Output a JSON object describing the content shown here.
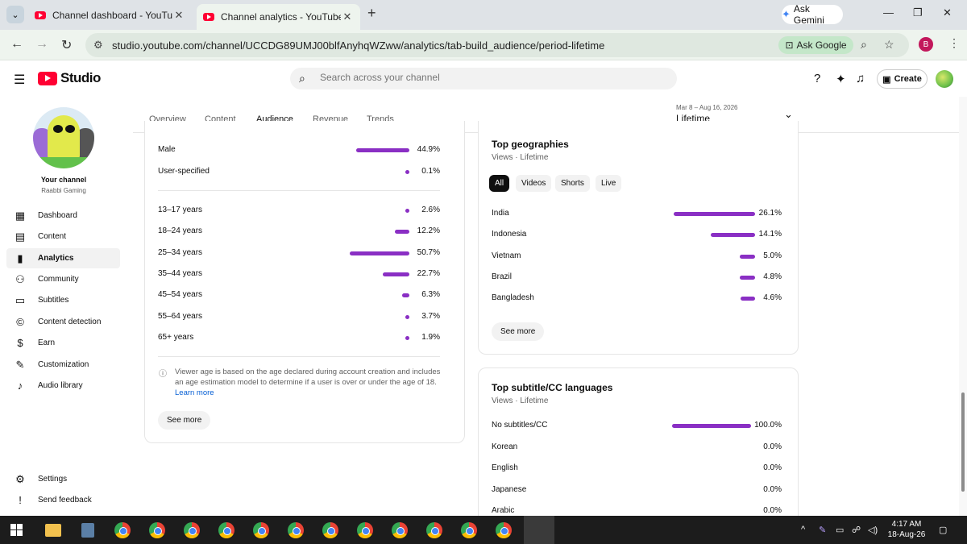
{
  "browser": {
    "tabs": [
      {
        "title": "Channel dashboard - YouTube Studio",
        "active": false
      },
      {
        "title": "Channel analytics - YouTube Studio",
        "active": true
      }
    ],
    "gemini_label": "Ask Gemini",
    "url": "studio.youtube.com/channel/UCCDG89UMJ00blfAnyhqWZww/analytics/tab-build_audience/period-lifetime",
    "ask_google_label": "Ask Google",
    "profile_initial": "B"
  },
  "studio": {
    "logo_text": "Studio",
    "search_placeholder": "Search across your channel",
    "create_label": "Create"
  },
  "sidebar": {
    "channel_label": "Your channel",
    "channel_name": "Raabbi Gaming",
    "items": [
      {
        "label": "Dashboard",
        "icon": "dashboard-icon",
        "active": false
      },
      {
        "label": "Content",
        "icon": "content-icon",
        "active": false
      },
      {
        "label": "Analytics",
        "icon": "analytics-icon",
        "active": true
      },
      {
        "label": "Community",
        "icon": "community-icon",
        "active": false
      },
      {
        "label": "Subtitles",
        "icon": "subtitles-icon",
        "active": false
      },
      {
        "label": "Content detection",
        "icon": "copyright-icon",
        "active": false
      },
      {
        "label": "Earn",
        "icon": "earn-icon",
        "active": false
      },
      {
        "label": "Customization",
        "icon": "customization-icon",
        "active": false
      },
      {
        "label": "Audio library",
        "icon": "audio-library-icon",
        "active": false
      }
    ],
    "bottom_items": [
      {
        "label": "Settings",
        "icon": "gear-icon"
      },
      {
        "label": "Send feedback",
        "icon": "feedback-icon"
      }
    ]
  },
  "analytics_tabs": [
    {
      "label": "Overview",
      "active": false
    },
    {
      "label": "Content",
      "active": false
    },
    {
      "label": "Audience",
      "active": true
    },
    {
      "label": "Revenue",
      "active": false
    },
    {
      "label": "Trends",
      "active": false
    }
  ],
  "period": {
    "range": "Mar 8 – Aug 16, 2026",
    "label": "Lifetime"
  },
  "age_gender_card": {
    "gender_rows": [
      {
        "label": "Male",
        "value": 44.9,
        "pct": "44.9%"
      },
      {
        "label": "User-specified",
        "value": 0.1,
        "pct": "0.1%"
      }
    ],
    "age_rows": [
      {
        "label": "13–17 years",
        "value": 2.6,
        "pct": "2.6%"
      },
      {
        "label": "18–24 years",
        "value": 12.2,
        "pct": "12.2%"
      },
      {
        "label": "25–34 years",
        "value": 50.7,
        "pct": "50.7%"
      },
      {
        "label": "35–44 years",
        "value": 22.7,
        "pct": "22.7%"
      },
      {
        "label": "45–54 years",
        "value": 6.3,
        "pct": "6.3%"
      },
      {
        "label": "55–64 years",
        "value": 3.7,
        "pct": "3.7%"
      },
      {
        "label": "65+ years",
        "value": 1.9,
        "pct": "1.9%"
      }
    ],
    "info_text_1": "Viewer age is based on the age declared during account creation and includes",
    "info_text_2": "an age estimation model to determine if a user is over or under the age of 18.",
    "learn_more": "Learn more",
    "see_more": "See more"
  },
  "geo_card": {
    "title": "Top geographies",
    "subtitle": "Views · Lifetime",
    "chips": [
      {
        "label": "All",
        "active": true
      },
      {
        "label": "Videos",
        "active": false
      },
      {
        "label": "Shorts",
        "active": false
      },
      {
        "label": "Live",
        "active": false
      }
    ],
    "rows": [
      {
        "label": "India",
        "value": 26.1,
        "pct": "26.1%"
      },
      {
        "label": "Indonesia",
        "value": 14.1,
        "pct": "14.1%"
      },
      {
        "label": "Vietnam",
        "value": 5.0,
        "pct": "5.0%"
      },
      {
        "label": "Brazil",
        "value": 4.8,
        "pct": "4.8%"
      },
      {
        "label": "Bangladesh",
        "value": 4.6,
        "pct": "4.6%"
      }
    ],
    "see_more": "See more"
  },
  "subtitle_card": {
    "title": "Top subtitle/CC languages",
    "subtitle": "Views · Lifetime",
    "rows": [
      {
        "label": "No subtitles/CC",
        "value": 100.0,
        "pct": "100.0%"
      },
      {
        "label": "Korean",
        "value": 0.0,
        "pct": "0.0%"
      },
      {
        "label": "English",
        "value": 0.0,
        "pct": "0.0%"
      },
      {
        "label": "Japanese",
        "value": 0.0,
        "pct": "0.0%"
      },
      {
        "label": "Arabic",
        "value": 0.0,
        "pct": "0.0%"
      }
    ]
  },
  "taskbar": {
    "time": "4:17 AM",
    "date": "18-Aug-26"
  },
  "colors": {
    "accent_bar": "#8a2fc4",
    "youtube_red": "#ff0033"
  }
}
